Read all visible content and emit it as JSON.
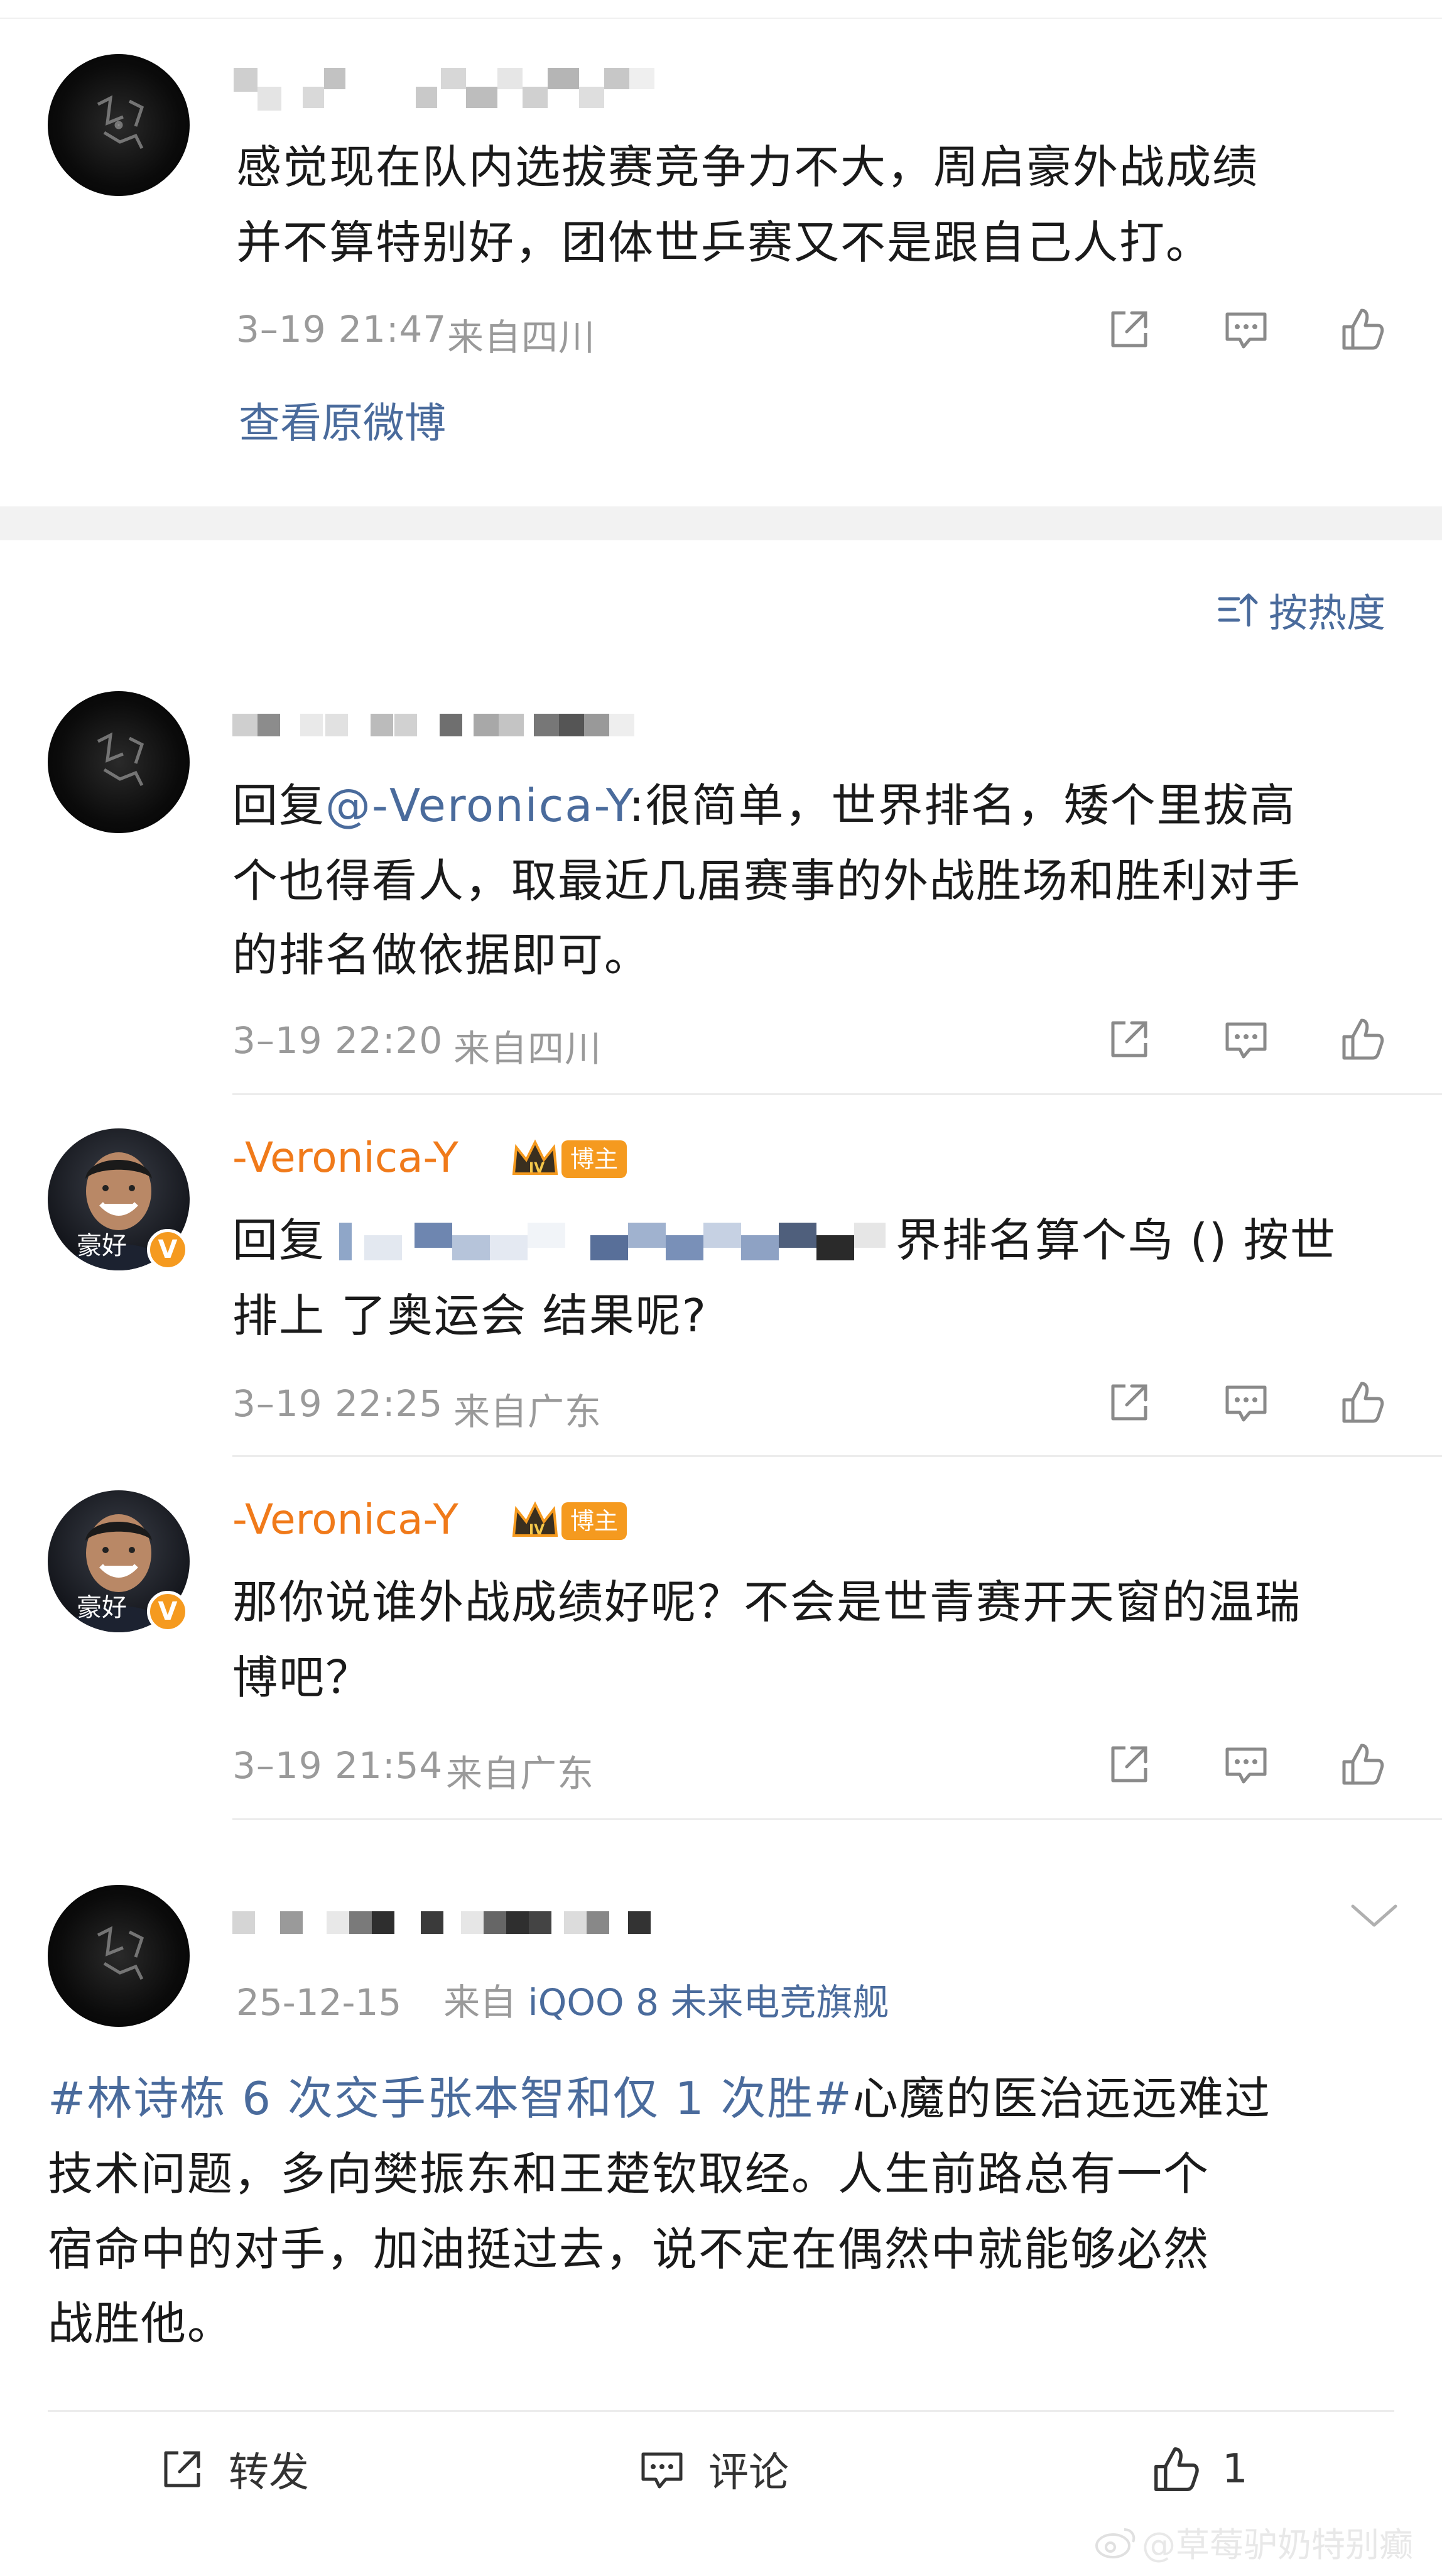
{
  "post": {
    "text_line1": "感觉现在队内选拔赛竞争力不大，周启豪外战成绩",
    "text_line2": "并不算特别好，团体世乒赛又不是跟自己人打。",
    "time": "3–19 21:47",
    "location": "来自四川",
    "view_original": "查看原微博"
  },
  "sort": {
    "label": "按热度",
    "icon": "sort-icon"
  },
  "comments": [
    {
      "reply_prefix": "回复",
      "mention": "@-Veronica-Y",
      "line1_rest": ":很简单，世界排名，矮个里拔高",
      "line2": "个也得看人，取最近几届赛事的外战胜场和胜利对手",
      "line3": "的排名做依据即可。",
      "time": "3–19 22:20",
      "location": "来自四川"
    },
    {
      "author": "-Veronica-Y",
      "badge_label": "博主",
      "avatar_caption": "豪好",
      "line1_prefix": "回复",
      "line1_suffix": "界排名算个鸟 () 按世",
      "line2": "排上 了奥运会 结果呢?",
      "time": "3–19 22:25",
      "location": "来自广东"
    },
    {
      "author": "-Veronica-Y",
      "badge_label": "博主",
      "avatar_caption": "豪好",
      "line1": "那你说谁外战成绩好呢？不会是世青赛开天窗的温瑞",
      "line2": "博吧？",
      "time": "3–19 21:54",
      "location": "来自广东"
    }
  ],
  "second_post": {
    "date": "25-12-15",
    "source_prefix": "来自",
    "source": "iQOO 8 未来电竞旗舰",
    "hashtag": "#林诗栋 6 次交手张本智和仅 1 次胜#",
    "line1_rest": "心魔的医治远远难过",
    "line2": "技术问题，多向樊振东和王楚钦取经。人生前路总有一个",
    "line3": "宿命中的对手，加油挺过去，说不定在偶然中就能够必然",
    "line4": "战胜他。"
  },
  "bottom_bar": {
    "repost_label": "转发",
    "comment_label": "评论",
    "like_count": "1"
  },
  "watermark": "@草莓驴奶特别癫",
  "colors": {
    "link": "#4a6b9c",
    "author": "#f07a1a",
    "meta": "#9a9a9a",
    "badge": "#f59a1f"
  }
}
